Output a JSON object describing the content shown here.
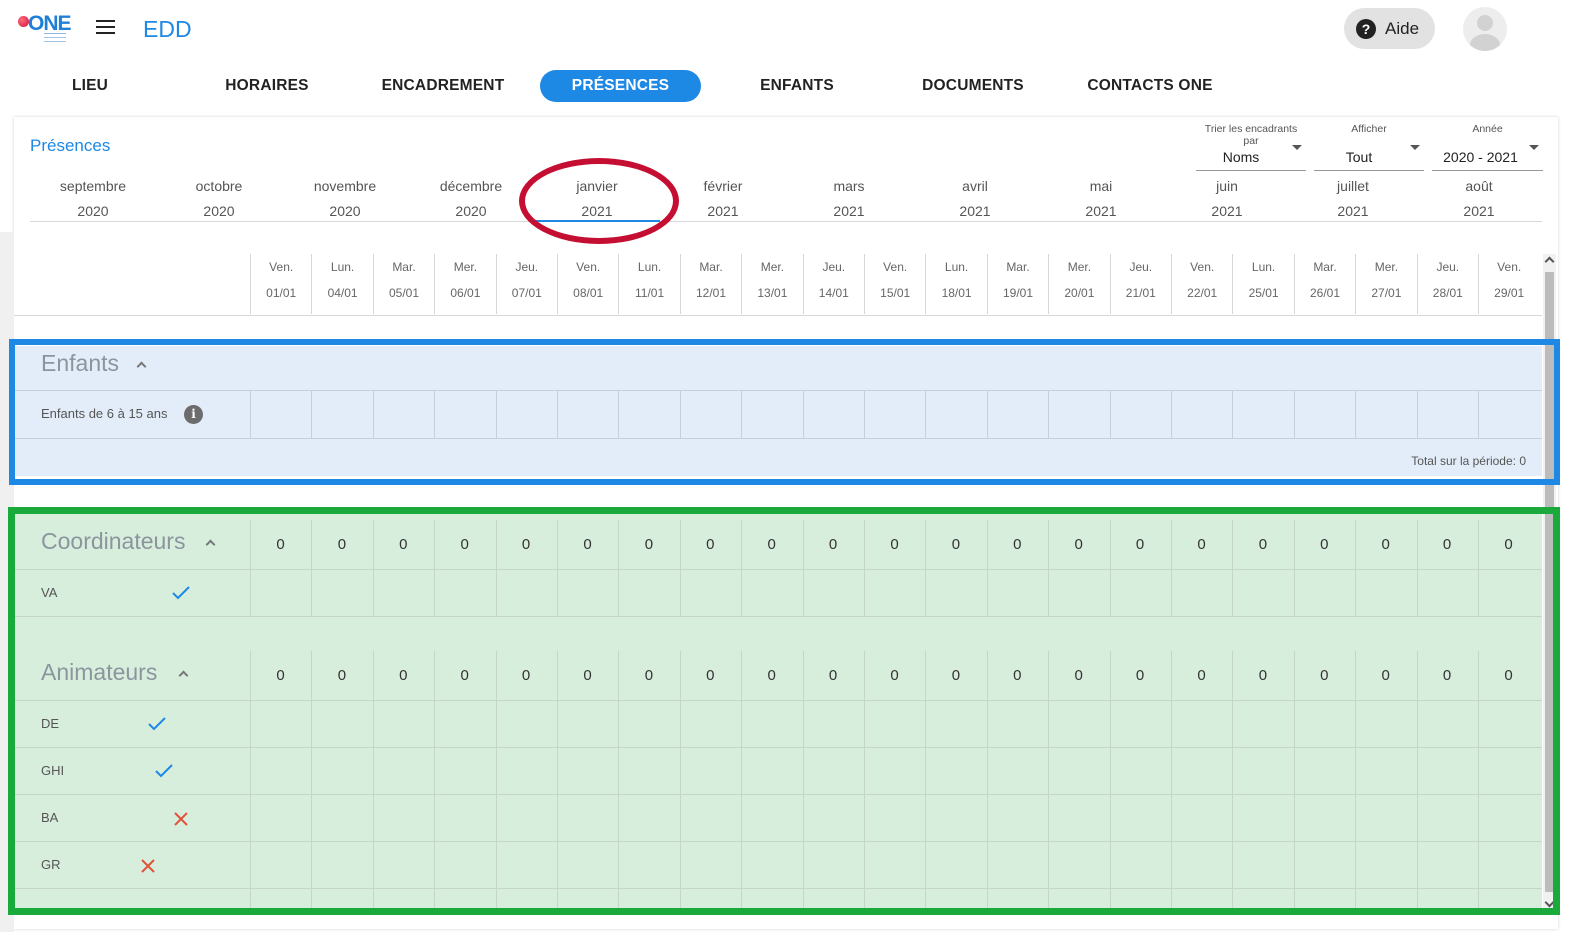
{
  "header": {
    "logo_text": "ONE",
    "app_title": "EDD",
    "help_label": "Aide"
  },
  "tabs": [
    {
      "label": "LIEU",
      "active": false
    },
    {
      "label": "HORAIRES",
      "active": false
    },
    {
      "label": "ENCADREMENT",
      "active": false
    },
    {
      "label": "PRÉSENCES",
      "active": true
    },
    {
      "label": "ENFANTS",
      "active": false
    },
    {
      "label": "DOCUMENTS",
      "active": false
    },
    {
      "label": "CONTACTS ONE",
      "active": false
    }
  ],
  "page": {
    "heading": "Présences"
  },
  "filters": {
    "sort": {
      "label": "Trier les encadrants par",
      "value": "Noms"
    },
    "display": {
      "label": "Afficher",
      "value": "Tout"
    },
    "year": {
      "label": "Année",
      "value": "2020 - 2021"
    }
  },
  "months": [
    {
      "name": "septembre",
      "year": "2020"
    },
    {
      "name": "octobre",
      "year": "2020"
    },
    {
      "name": "novembre",
      "year": "2020"
    },
    {
      "name": "décembre",
      "year": "2020"
    },
    {
      "name": "janvier",
      "year": "2021",
      "active": true
    },
    {
      "name": "février",
      "year": "2021"
    },
    {
      "name": "mars",
      "year": "2021"
    },
    {
      "name": "avril",
      "year": "2021"
    },
    {
      "name": "mai",
      "year": "2021"
    },
    {
      "name": "juin",
      "year": "2021"
    },
    {
      "name": "juillet",
      "year": "2021"
    },
    {
      "name": "août",
      "year": "2021"
    }
  ],
  "days": [
    {
      "day": "Ven.",
      "date": "01/01"
    },
    {
      "day": "Lun.",
      "date": "04/01"
    },
    {
      "day": "Mar.",
      "date": "05/01"
    },
    {
      "day": "Mer.",
      "date": "06/01"
    },
    {
      "day": "Jeu.",
      "date": "07/01"
    },
    {
      "day": "Ven.",
      "date": "08/01"
    },
    {
      "day": "Lun.",
      "date": "11/01"
    },
    {
      "day": "Mar.",
      "date": "12/01"
    },
    {
      "day": "Mer.",
      "date": "13/01"
    },
    {
      "day": "Jeu.",
      "date": "14/01"
    },
    {
      "day": "Ven.",
      "date": "15/01"
    },
    {
      "day": "Lun.",
      "date": "18/01"
    },
    {
      "day": "Mar.",
      "date": "19/01"
    },
    {
      "day": "Mer.",
      "date": "20/01"
    },
    {
      "day": "Jeu.",
      "date": "21/01"
    },
    {
      "day": "Ven.",
      "date": "22/01"
    },
    {
      "day": "Lun.",
      "date": "25/01"
    },
    {
      "day": "Mar.",
      "date": "26/01"
    },
    {
      "day": "Mer.",
      "date": "27/01"
    },
    {
      "day": "Jeu.",
      "date": "28/01"
    },
    {
      "day": "Ven.",
      "date": "29/01"
    }
  ],
  "enfants": {
    "title": "Enfants",
    "row_label": "Enfants de 6 à 15 ans",
    "info_glyph": "i",
    "total": "Total sur la période: 0"
  },
  "coordinateurs": {
    "title": "Coordinateurs",
    "counts": [
      "0",
      "0",
      "0",
      "0",
      "0",
      "0",
      "0",
      "0",
      "0",
      "0",
      "0",
      "0",
      "0",
      "0",
      "0",
      "0",
      "0",
      "0",
      "0",
      "0",
      "0"
    ],
    "people": [
      {
        "initials": "VA",
        "status": "check-icon"
      }
    ]
  },
  "animateurs": {
    "title": "Animateurs",
    "counts": [
      "0",
      "0",
      "0",
      "0",
      "0",
      "0",
      "0",
      "0",
      "0",
      "0",
      "0",
      "0",
      "0",
      "0",
      "0",
      "0",
      "0",
      "0",
      "0",
      "0",
      "0"
    ],
    "people": [
      {
        "initials": "DE",
        "status": "check-icon"
      },
      {
        "initials": "GHI",
        "status": "check-icon"
      },
      {
        "initials": "BA",
        "status": "cross-icon"
      },
      {
        "initials": "GR",
        "status": "cross-icon"
      }
    ]
  },
  "colors": {
    "accent": "#1e88e5",
    "check": "#1e88e5",
    "cross": "#e0533a",
    "annotation_red": "#c50f32",
    "annotation_blue": "#1e88e5",
    "annotation_green": "#1aaa3c"
  }
}
